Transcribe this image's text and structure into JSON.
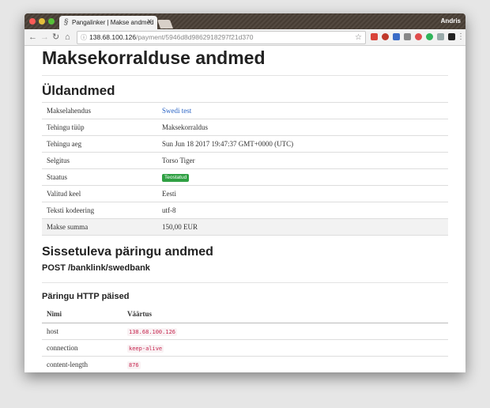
{
  "browser": {
    "tab_title": "Pangalinker | Makse andmed",
    "profile_name": "Andris",
    "url_host": "138.68.100.126",
    "url_path": "/payment/5946d8d9862918297f21d370"
  },
  "page": {
    "title": "Maksekorralduse andmed",
    "general": {
      "heading": "Üldandmed",
      "rows": [
        {
          "label": "Makselahendus",
          "value": "Swedi test"
        },
        {
          "label": "Tehingu tüüp",
          "value": "Maksekorraldus"
        },
        {
          "label": "Tehingu aeg",
          "value": "Sun Jun 18 2017 19:47:37 GMT+0000 (UTC)"
        },
        {
          "label": "Selgitus",
          "value": "Torso Tiger"
        },
        {
          "label": "Staatus",
          "value": "Teostatud"
        },
        {
          "label": "Valitud keel",
          "value": "Eesti"
        },
        {
          "label": "Teksti kodeering",
          "value": "utf-8"
        },
        {
          "label": "Makse summa",
          "value": "150,00 EUR"
        }
      ]
    },
    "incoming": {
      "heading": "Sissetuleva päringu andmed",
      "endpoint": "POST /banklink/swedbank",
      "headers_heading": "Päringu HTTP päised",
      "columns": {
        "name": "Nimi",
        "value": "Väärtus"
      },
      "rows": [
        {
          "name": "host",
          "value": "138.68.100.126"
        },
        {
          "name": "connection",
          "value": "keep-alive"
        },
        {
          "name": "content-length",
          "value": "876"
        }
      ]
    }
  }
}
